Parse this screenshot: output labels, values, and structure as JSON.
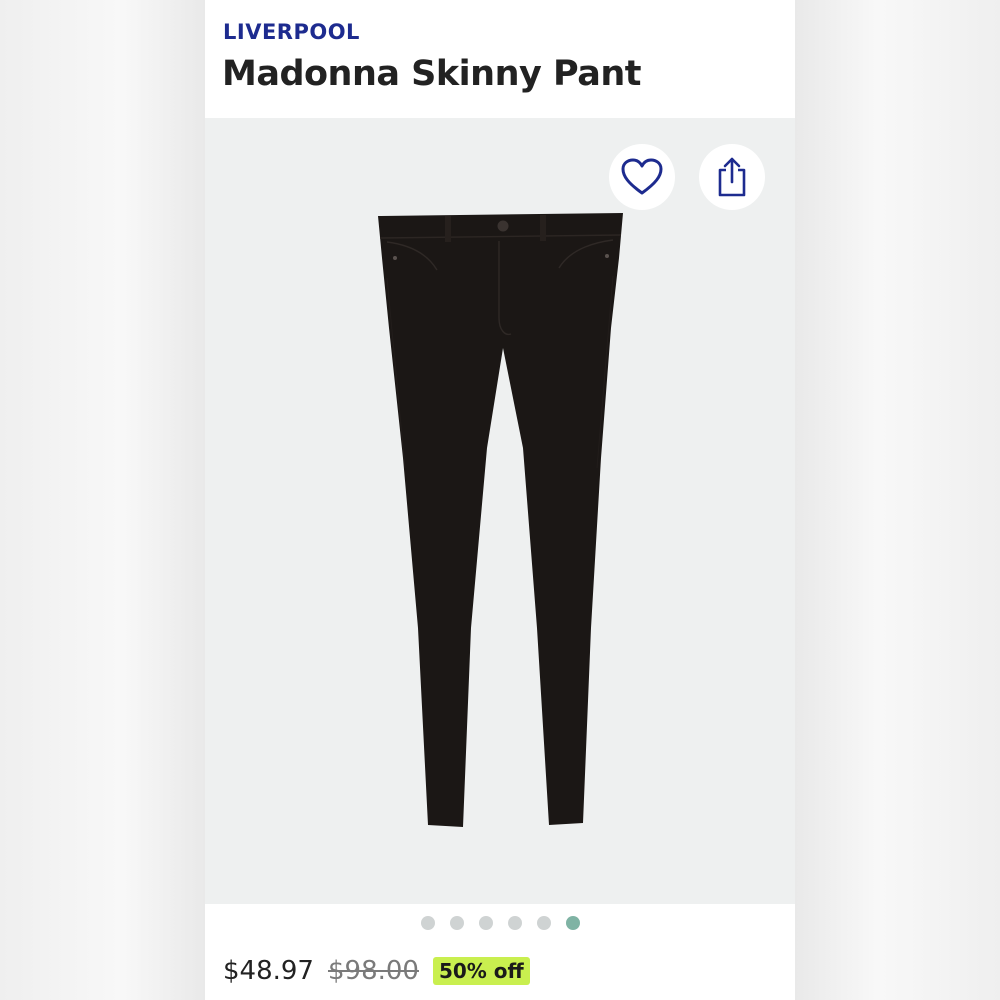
{
  "product": {
    "brand": "LIVERPOOL",
    "name": "Madonna Skinny Pant",
    "image_alt": "black skinny pants",
    "price": "$48.97",
    "original_price": "$98.00",
    "discount": "50% off"
  },
  "actions": {
    "favorite_icon": "heart-icon",
    "share_icon": "share-icon"
  },
  "carousel": {
    "total": 6,
    "active_index": 5
  },
  "colors": {
    "brand": "#1d2b8f",
    "discount_badge": "#c9ef4f",
    "active_dot": "#7fb3a4",
    "inactive_dot": "#cfd3d3",
    "image_bg": "#eef0f0"
  }
}
